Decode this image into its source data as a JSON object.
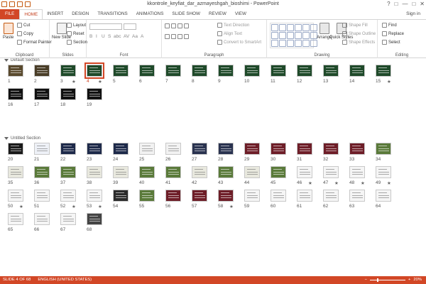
{
  "window": {
    "title": "kkontrole_keyfiat_dar_azmayeshgah_bioshimi - PowerPoint",
    "controls": [
      "?",
      "□",
      "—",
      "□",
      "✕"
    ]
  },
  "ribbon_tabs": [
    "FILE",
    "HOME",
    "INSERT",
    "DESIGN",
    "TRANSITIONS",
    "ANIMATIONS",
    "SLIDE SHOW",
    "REVIEW",
    "VIEW"
  ],
  "active_tab": "HOME",
  "sign_in": "Sign in",
  "ribbon": {
    "clipboard": {
      "label": "Clipboard",
      "paste": "Paste",
      "cut": "Cut",
      "copy": "Copy",
      "format_painter": "Format Painter"
    },
    "slides": {
      "label": "Slides",
      "new_slide": "New Slide",
      "layout": "Layout",
      "reset": "Reset",
      "section": "Section"
    },
    "font": {
      "label": "Font",
      "format_buttons": [
        "B",
        "I",
        "U",
        "S",
        "abc",
        "AV",
        "Aa",
        "A"
      ]
    },
    "paragraph": {
      "label": "Paragraph",
      "text_direction": "Text Direction",
      "align_text": "Align Text",
      "convert_smartart": "Convert to SmartArt"
    },
    "drawing": {
      "label": "Drawing",
      "arrange": "Arrange",
      "quick_styles": "Quick Styles",
      "shape_fill": "Shape Fill",
      "shape_outline": "Shape Outline",
      "shape_effects": "Shape Effects"
    },
    "editing": {
      "label": "Editing",
      "find": "Find",
      "replace": "Replace",
      "select": "Select"
    }
  },
  "sections": [
    {
      "name": "Default Section",
      "slides": [
        {
          "n": "1",
          "bg": "#5a4a2e",
          "star": false
        },
        {
          "n": "2",
          "bg": "#4a3e28",
          "star": false
        },
        {
          "n": "3",
          "bg": "#1f4a2a",
          "star": true
        },
        {
          "n": "4",
          "bg": "#1f4a2a",
          "star": true,
          "selected": true
        },
        {
          "n": "5",
          "bg": "#1f4a2a",
          "star": false
        },
        {
          "n": "6",
          "bg": "#1f4a2a",
          "star": false
        },
        {
          "n": "7",
          "bg": "#1f4a2a",
          "star": false
        },
        {
          "n": "8",
          "bg": "#1f4a2a",
          "star": false
        },
        {
          "n": "9",
          "bg": "#1f4a2a",
          "star": false
        },
        {
          "n": "10",
          "bg": "#1f4a2a",
          "star": false
        },
        {
          "n": "11",
          "bg": "#1f4a2a",
          "star": false
        },
        {
          "n": "12",
          "bg": "#1f4a2a",
          "star": false
        },
        {
          "n": "13",
          "bg": "#1f4a2a",
          "star": false
        },
        {
          "n": "14",
          "bg": "#1f4a2a",
          "star": false
        },
        {
          "n": "15",
          "bg": "#1f4a2a",
          "star": true
        },
        {
          "n": "16",
          "bg": "#111111",
          "star": false
        },
        {
          "n": "17",
          "bg": "#111111",
          "star": false
        },
        {
          "n": "18",
          "bg": "#111111",
          "star": false
        },
        {
          "n": "19",
          "bg": "#111111",
          "star": false
        }
      ]
    },
    {
      "name": "Untitled Section",
      "slides": [
        {
          "n": "20",
          "bg": "#1a1a1a",
          "star": false
        },
        {
          "n": "21",
          "bg": "#eef1f7",
          "star": false
        },
        {
          "n": "22",
          "bg": "#1e2a4a",
          "star": false
        },
        {
          "n": "23",
          "bg": "#1e2a4a",
          "star": false
        },
        {
          "n": "24",
          "bg": "#1e2a4a",
          "star": false
        },
        {
          "n": "25",
          "bg": "#f2f2f2",
          "star": false
        },
        {
          "n": "26",
          "bg": "#f2f2f2",
          "star": false
        },
        {
          "n": "27",
          "bg": "#2a3350",
          "star": false
        },
        {
          "n": "28",
          "bg": "#2a3350",
          "star": false
        },
        {
          "n": "29",
          "bg": "#6e1e28",
          "star": false
        },
        {
          "n": "30",
          "bg": "#6e1e28",
          "star": false
        },
        {
          "n": "31",
          "bg": "#6e1e28",
          "star": false
        },
        {
          "n": "32",
          "bg": "#6e1e28",
          "star": false
        },
        {
          "n": "33",
          "bg": "#6e1e28",
          "star": false
        },
        {
          "n": "34",
          "bg": "#5a7a3a",
          "star": false
        },
        {
          "n": "35",
          "bg": "#e8e8de",
          "star": false
        },
        {
          "n": "36",
          "bg": "#5a7a3a",
          "star": false
        },
        {
          "n": "37",
          "bg": "#5a7a3a",
          "star": false
        },
        {
          "n": "38",
          "bg": "#e8e8de",
          "star": false
        },
        {
          "n": "39",
          "bg": "#e8e8de",
          "star": false
        },
        {
          "n": "40",
          "bg": "#5a7a3a",
          "star": false
        },
        {
          "n": "41",
          "bg": "#5a7a3a",
          "star": false
        },
        {
          "n": "42",
          "bg": "#e8e8de",
          "star": false
        },
        {
          "n": "43",
          "bg": "#5a7a3a",
          "star": false
        },
        {
          "n": "44",
          "bg": "#e8e8de",
          "star": false
        },
        {
          "n": "45",
          "bg": "#5a7a3a",
          "star": false
        },
        {
          "n": "46",
          "bg": "#f5f5f5",
          "star": true
        },
        {
          "n": "47",
          "bg": "#f5f5f5",
          "star": true
        },
        {
          "n": "48",
          "bg": "#f5f5f5",
          "star": true
        },
        {
          "n": "49",
          "bg": "#f5f5f5",
          "star": true
        },
        {
          "n": "50",
          "bg": "#f5f5f5",
          "star": true
        },
        {
          "n": "51",
          "bg": "#f5f5f5",
          "star": false
        },
        {
          "n": "52",
          "bg": "#f5f5f5",
          "star": true
        },
        {
          "n": "53",
          "bg": "#f5f5f5",
          "star": true
        },
        {
          "n": "54",
          "bg": "#2b2b2b",
          "star": false
        },
        {
          "n": "55",
          "bg": "#5a7a3a",
          "star": false
        },
        {
          "n": "56",
          "bg": "#6e1e28",
          "star": false
        },
        {
          "n": "57",
          "bg": "#6e1e28",
          "star": false
        },
        {
          "n": "58",
          "bg": "#6e1e28",
          "star": true
        },
        {
          "n": "59",
          "bg": "#f5f5f5",
          "star": false
        },
        {
          "n": "60",
          "bg": "#f5f5f5",
          "star": false
        },
        {
          "n": "61",
          "bg": "#f5f5f5",
          "star": false
        },
        {
          "n": "62",
          "bg": "#f5f5f5",
          "star": false
        },
        {
          "n": "63",
          "bg": "#f5f5f5",
          "star": false
        },
        {
          "n": "64",
          "bg": "#f5f5f5",
          "star": false
        },
        {
          "n": "65",
          "bg": "#f5f5f5",
          "star": false
        },
        {
          "n": "66",
          "bg": "#f5f5f5",
          "star": false
        },
        {
          "n": "67",
          "bg": "#f5f5f5",
          "star": false
        },
        {
          "n": "68",
          "bg": "#444444",
          "star": false
        }
      ]
    }
  ],
  "status": {
    "slide_info": "SLIDE 4 OF 68",
    "language": "ENGLISH (UNITED STATES)",
    "zoom": "20%",
    "zoom_level": 0.2
  },
  "colors": {
    "accent": "#d24726",
    "selection": "#d24726"
  }
}
